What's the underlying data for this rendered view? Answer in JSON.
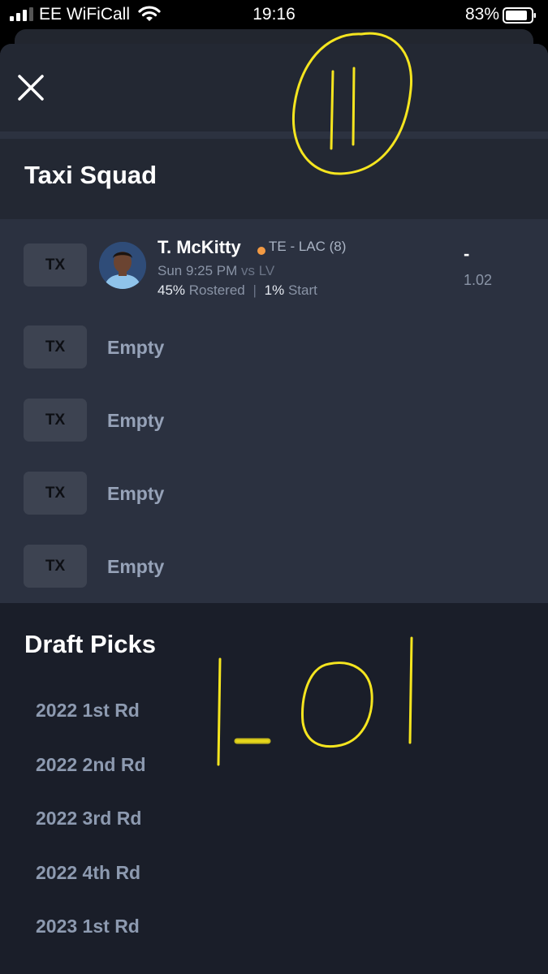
{
  "status_bar": {
    "carrier": "EE WiFiCall",
    "time": "19:16",
    "battery": "83%"
  },
  "icons": {
    "close": "close-icon",
    "signal": "signal-bars-icon",
    "wifi": "wifi-icon",
    "battery": "battery-icon"
  },
  "taxi_squad": {
    "title": "Taxi Squad",
    "player": {
      "slot": "TX",
      "name": "T. McKitty",
      "position_team": "TE - LAC (8)",
      "game_time": "Sun 9:25 PM",
      "opponent": "vs LV",
      "rostered_pct": "45%",
      "rostered_label": "Rostered",
      "start_pct": "1%",
      "start_label": "Start",
      "dash": "-",
      "pick_value": "1.02"
    },
    "empty_slots": [
      {
        "slot": "TX",
        "label": "Empty"
      },
      {
        "slot": "TX",
        "label": "Empty"
      },
      {
        "slot": "TX",
        "label": "Empty"
      },
      {
        "slot": "TX",
        "label": "Empty"
      }
    ]
  },
  "draft_picks": {
    "title": "Draft Picks",
    "items": [
      "2022 1st Rd",
      "2022 2nd Rd",
      "2022 3rd Rd",
      "2022 4th Rd",
      "2023 1st Rd"
    ]
  },
  "colors": {
    "sheet_bg": "#1a1e29",
    "list_bg": "#2b3140",
    "badge_bg": "#3d4351",
    "position_dot": "#f39a43",
    "annotation": "#ffee33"
  }
}
